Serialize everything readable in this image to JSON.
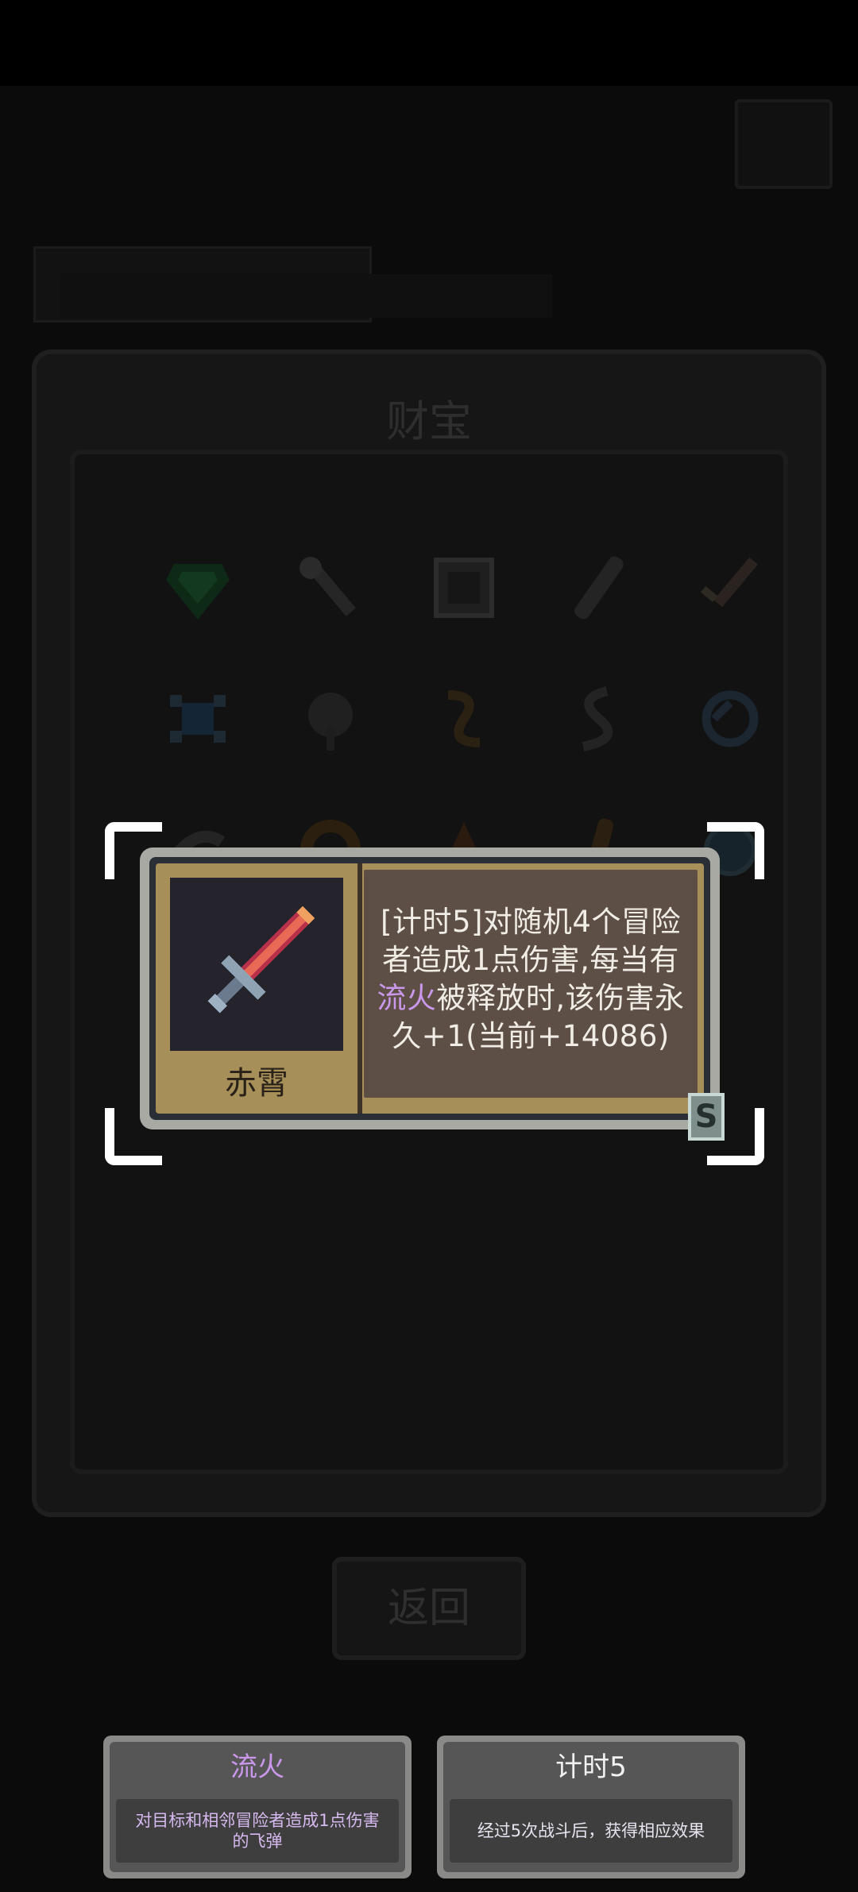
{
  "main_panel": {
    "title": "财宝"
  },
  "back_button": {
    "label": "返回"
  },
  "treasure_icons": [
    "gem-icon",
    "bone-icon",
    "rune-tablet-icon",
    "bone-club-icon",
    "dagger-icon",
    "amulet-icon",
    "flower-icon",
    "rope-icon",
    "serpent-icon",
    "swirl-icon",
    "horn-icon",
    "coil-icon",
    "cloak-icon",
    "scroll-icon",
    "orb-icon"
  ],
  "item_card": {
    "name": "赤霄",
    "icon": "red-sword-icon",
    "description_parts": [
      "[计时5]对随机4个冒险者造成1点伤害,每当有",
      "流火",
      "被释放时,该伤害永久+1(当前+14086)"
    ],
    "rarity": "S"
  },
  "keywords": [
    {
      "title": "流火",
      "description": "对目标和相邻冒险者造成1点伤害的飞弹"
    },
    {
      "title": "计时5",
      "description": "经过5次战斗后，获得相应效果"
    }
  ],
  "colors": {
    "highlight": "#c998ea",
    "card_gold": "#a68f58",
    "desc_bg": "#5d4f46"
  }
}
